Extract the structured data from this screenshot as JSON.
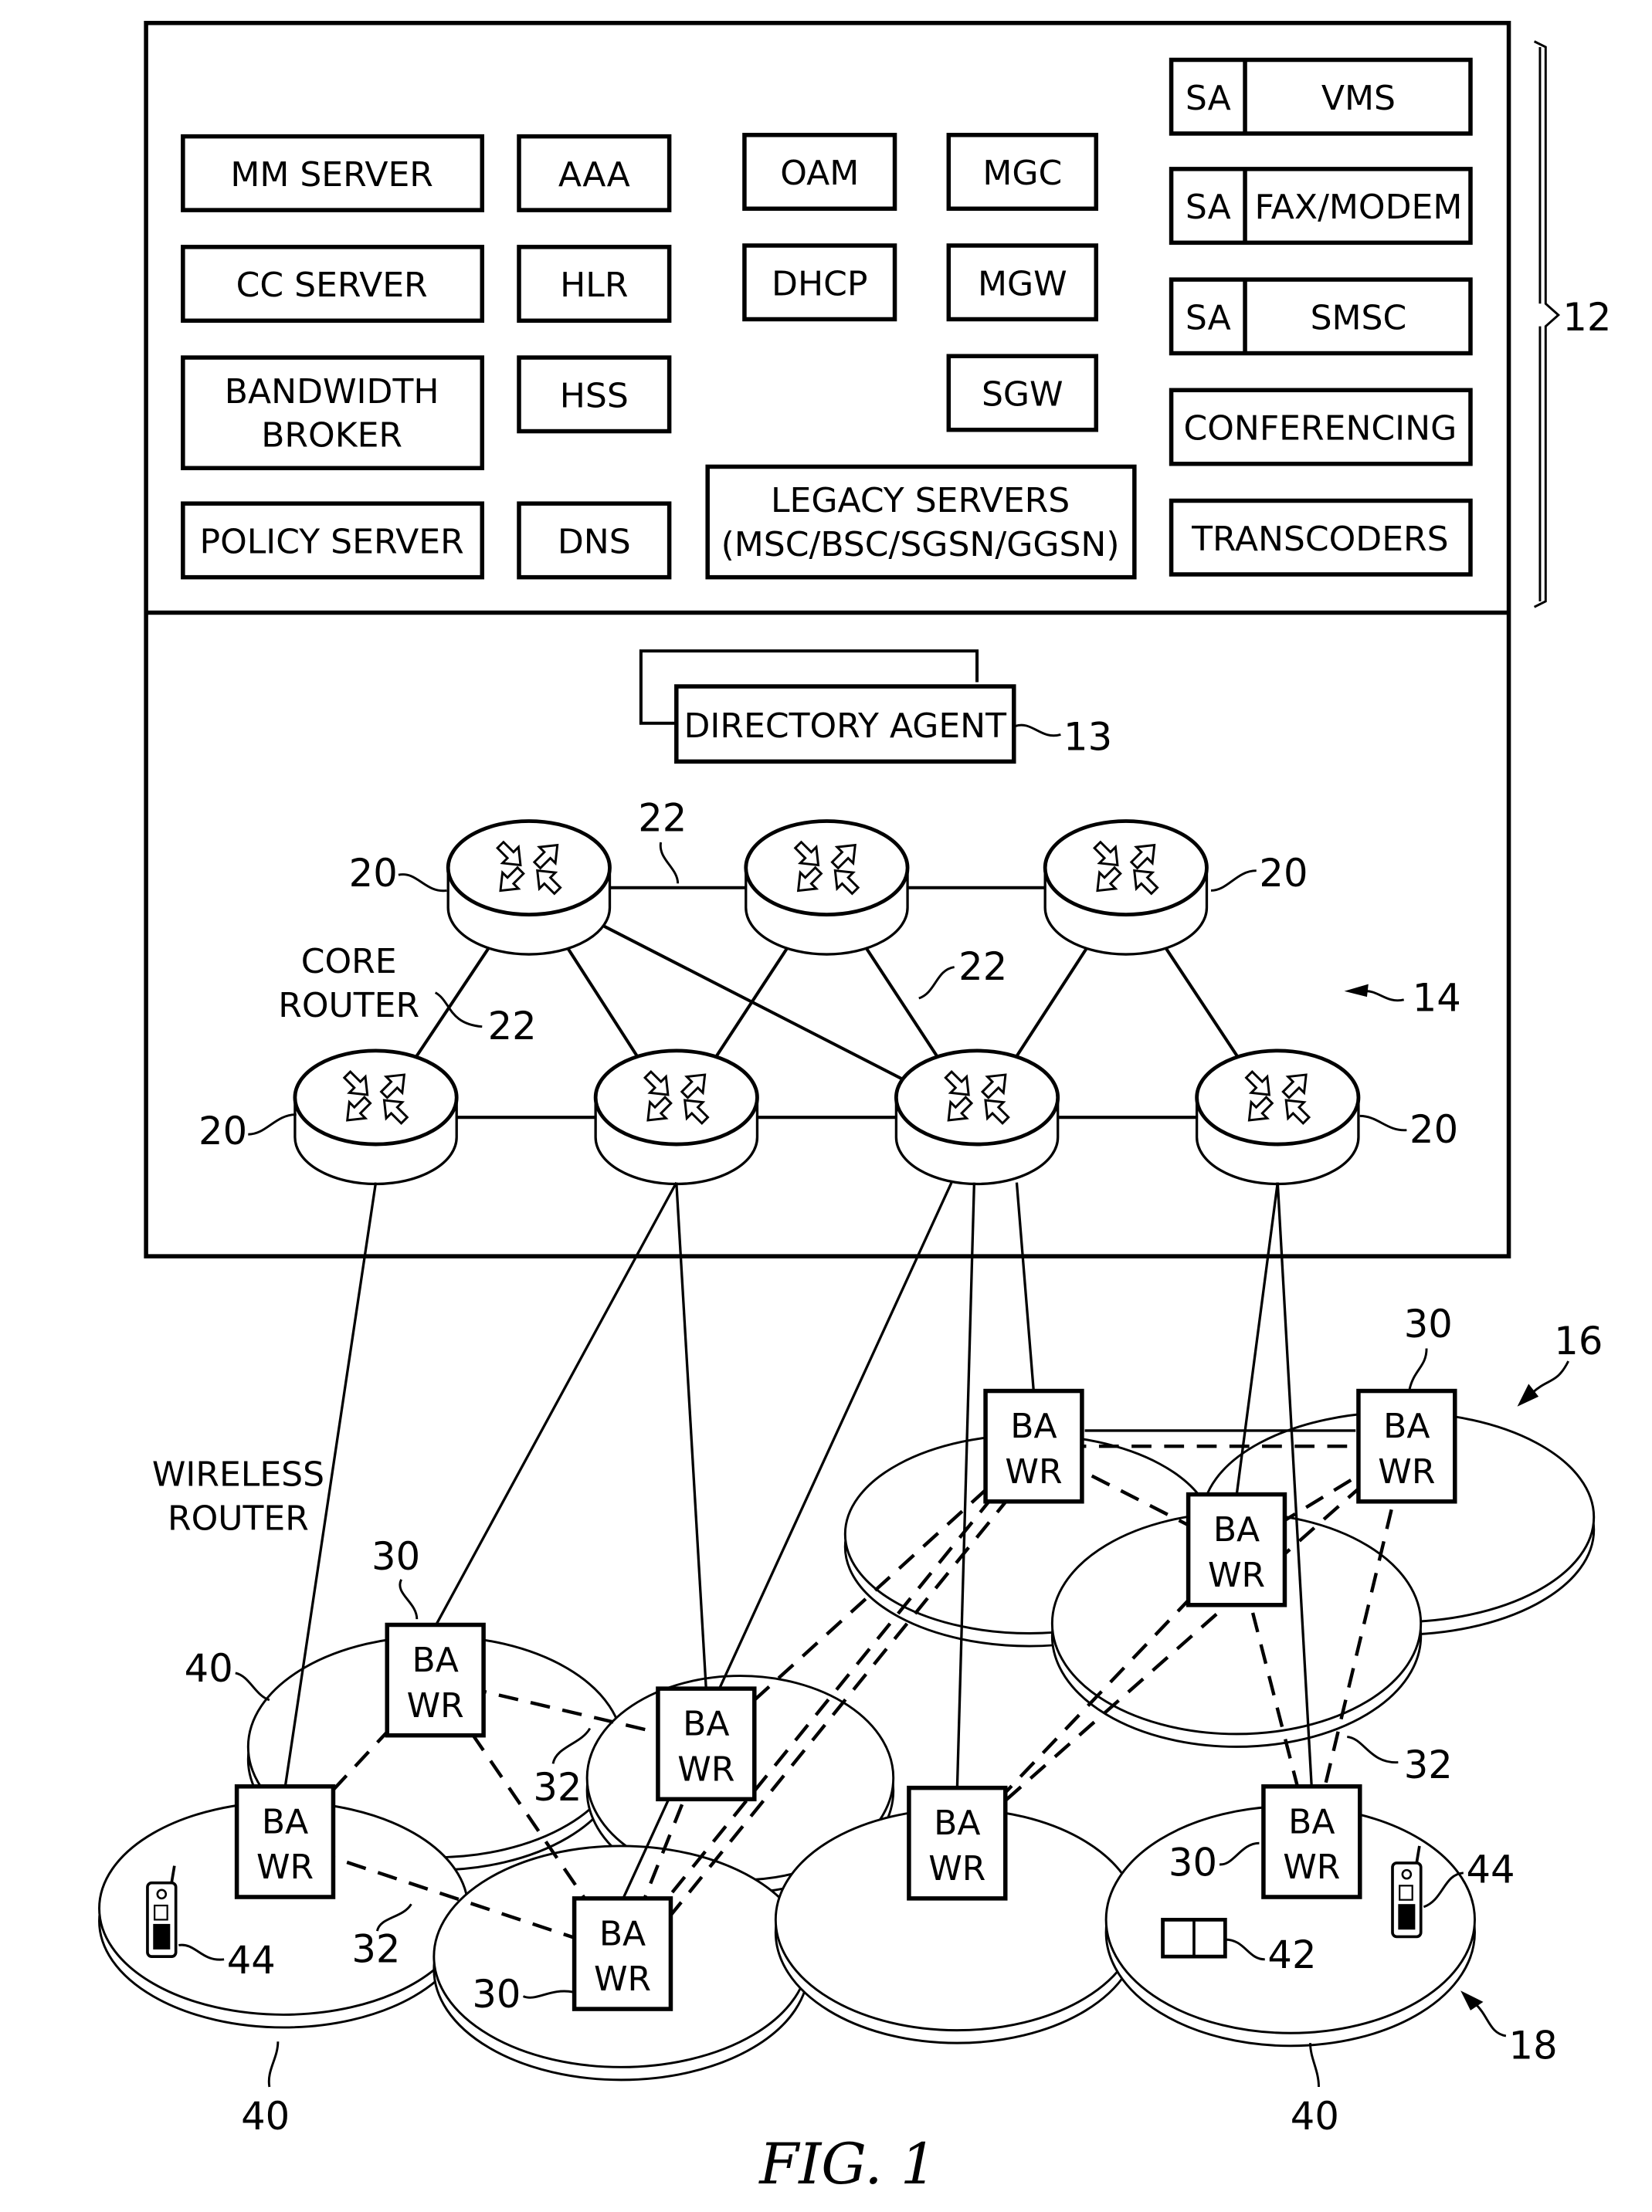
{
  "figure": {
    "caption": "FIG. 1",
    "service_layer": {
      "ref": "12",
      "servers": {
        "mm_server": "MM SERVER",
        "cc_server": "CC SERVER",
        "bandwidth_broker": [
          "BANDWIDTH",
          "BROKER"
        ],
        "policy_server": "POLICY SERVER",
        "aaa": "AAA",
        "hlr": "HLR",
        "hss": "HSS",
        "dns": "DNS",
        "oam": "OAM",
        "dhcp": "DHCP",
        "mgc": "MGC",
        "mgw": "MGW",
        "sgw": "SGW",
        "legacy_servers": [
          "LEGACY SERVERS",
          "(MSC/BSC/SGSN/GGSN)"
        ],
        "sa_vms": {
          "sa": "SA",
          "name": "VMS"
        },
        "sa_fax_modem": {
          "sa": "SA",
          "name": "FAX/MODEM"
        },
        "sa_smsc": {
          "sa": "SA",
          "name": "SMSC"
        },
        "conferencing": "CONFERENCING",
        "transcoders": "TRANSCODERS"
      }
    },
    "core_network": {
      "ref": "14",
      "directory_agent": {
        "label": "DIRECTORY AGENT",
        "ref": "13"
      },
      "core_router_label": [
        "CORE",
        "ROUTER"
      ],
      "router_ref": "20",
      "link_ref": "22"
    },
    "access_network": {
      "ref": "16",
      "wireless_router_label": [
        "WIRELESS",
        "ROUTER"
      ],
      "node_label": [
        "BA",
        "WR"
      ],
      "node_ref": "30",
      "wireless_link_ref": "32",
      "cell_ref": "40",
      "fixed_device_ref": "42",
      "mobile_device_ref": "44",
      "subscriber_ref": "18"
    }
  }
}
